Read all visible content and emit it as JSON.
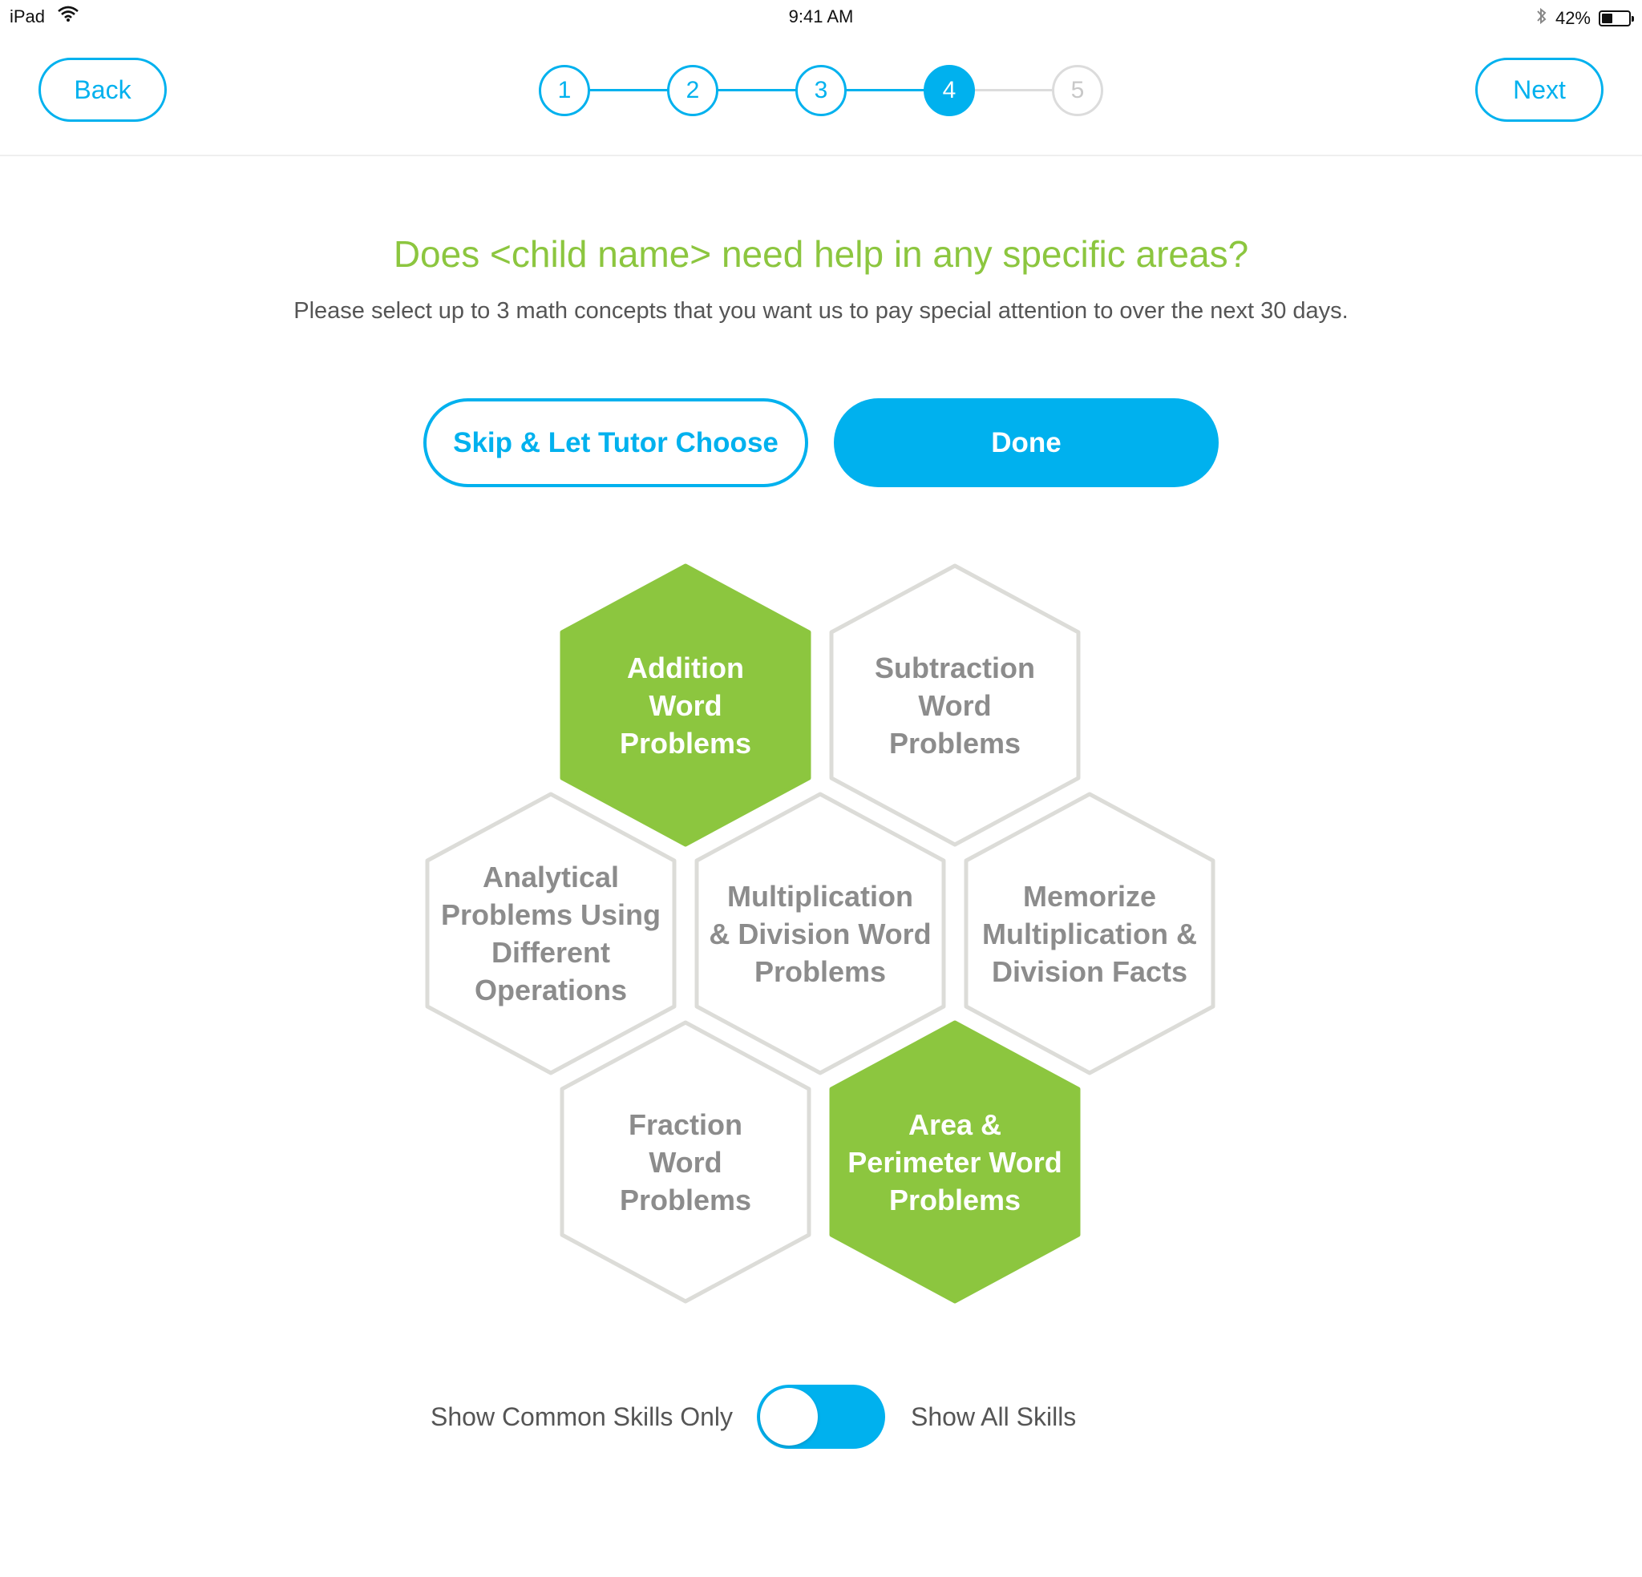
{
  "status_bar": {
    "device": "iPad",
    "time": "9:41 AM",
    "battery": "42%",
    "battery_level": 0.42
  },
  "nav": {
    "back_label": "Back",
    "next_label": "Next"
  },
  "stepper": {
    "steps": [
      "1",
      "2",
      "3",
      "4",
      "5"
    ],
    "current": 4
  },
  "question": {
    "title": "Does <child name> need help in any specific areas?",
    "subtitle": "Please select up to 3 math concepts that you want us to pay special attention to over the next 30 days."
  },
  "actions": {
    "skip_label": "Skip & Let Tutor Choose",
    "done_label": "Done"
  },
  "skills": [
    {
      "label": "Addition\nWord\nProblems",
      "selected": true
    },
    {
      "label": "Subtraction\nWord\nProblems",
      "selected": false
    },
    {
      "label": "Analytical\nProblems Using\nDifferent\nOperations",
      "selected": false
    },
    {
      "label": "Multiplication\n& Division Word\nProblems",
      "selected": false
    },
    {
      "label": "Memorize\nMultiplication &\nDivision Facts",
      "selected": false
    },
    {
      "label": "Fraction\nWord\nProblems",
      "selected": false
    },
    {
      "label": "Area &\nPerimeter Word\nProblems",
      "selected": true
    }
  ],
  "toggle": {
    "left_label": "Show Common Skills Only",
    "right_label": "Show All Skills",
    "state": "off"
  },
  "colors": {
    "accent": "#00b1ee",
    "selected": "#8cc63f",
    "hex_border": "#dcdcd8"
  }
}
